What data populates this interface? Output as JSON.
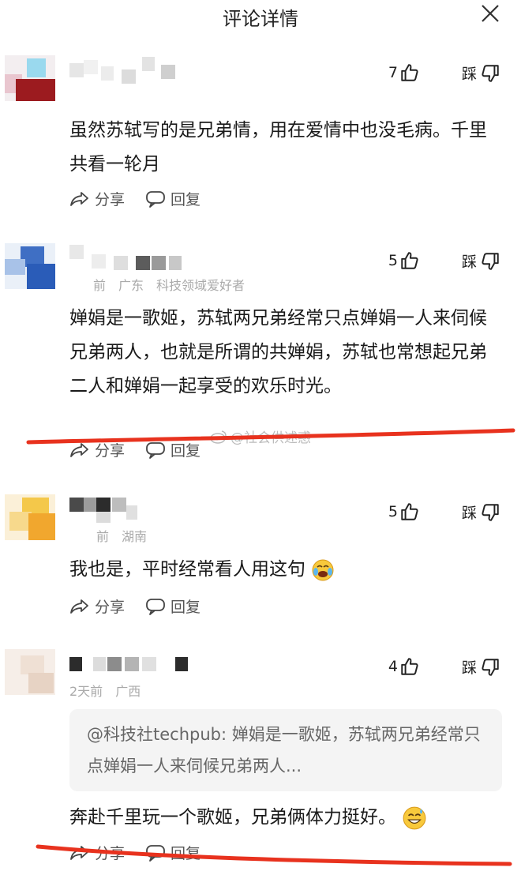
{
  "header": {
    "title": "评论详情"
  },
  "icons": {
    "close": "close-icon",
    "like": "thumbs-up-icon",
    "dislike": "thumbs-down-icon",
    "share": "share-icon",
    "reply": "reply-bubble-icon"
  },
  "labels": {
    "dislike": "踩",
    "share": "分享",
    "reply": "回复"
  },
  "watermark": "@社会供述惑",
  "comments": [
    {
      "meta_time": "",
      "meta_region": "",
      "meta_tag": "",
      "likes": "7",
      "text": "虽然苏轼写的是兄弟情，用在爱情中也没毛病。千里共看一轮月"
    },
    {
      "meta_time": "前",
      "meta_region": "广东",
      "meta_tag": "科技领域爱好者",
      "likes": "5",
      "text": "婵娟是一歌姬，苏轼两兄弟经常只点婵娟一人来伺候兄弟两人，也就是所谓的共婵娟，苏轼也常想起兄弟二人和婵娟一起享受的欢乐时光。"
    },
    {
      "meta_time": "前",
      "meta_region": "湖南",
      "meta_tag": "",
      "likes": "5",
      "text": "我也是，平时经常看人用这句"
    },
    {
      "meta_time": "2天前",
      "meta_region": "广西",
      "meta_tag": "",
      "likes": "4",
      "quote": "@科技社techpub: 婵娟是一歌姬，苏轼两兄弟经常只点婵娟一人来伺候兄弟两人...",
      "text": "奔赴千里玩一个歌姬，兄弟俩体力挺好。"
    }
  ],
  "colors": {
    "annotation_red": "#e8321e",
    "muted": "#aaaaaa"
  }
}
